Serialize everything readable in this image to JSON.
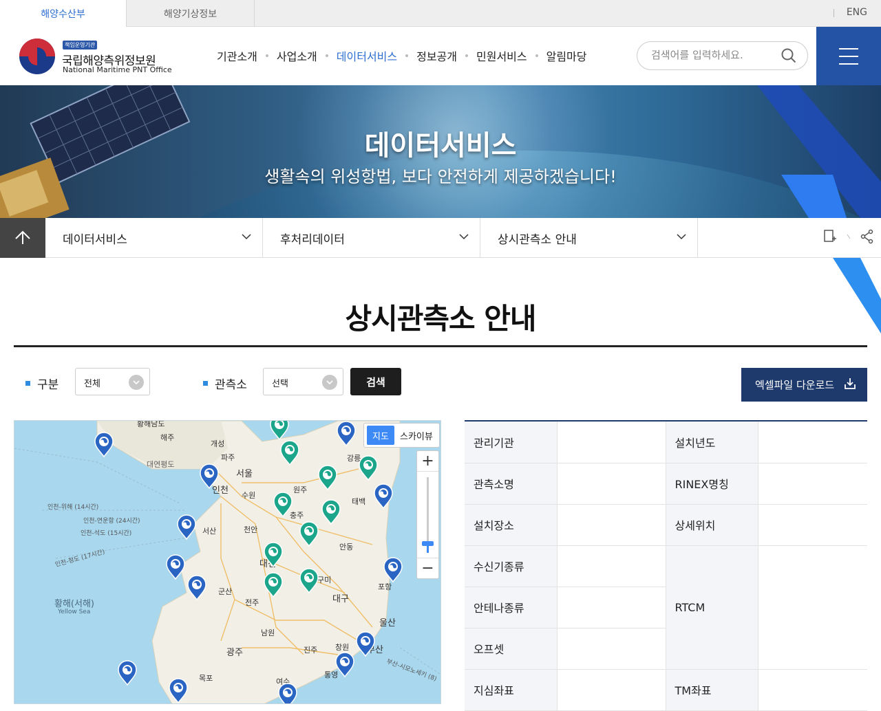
{
  "top_tabs": [
    "해양수산부",
    "해양기상정보"
  ],
  "lang": "ENG",
  "org": {
    "badge": "책임운영기관",
    "name": "국립해양측위정보원",
    "eng": "National Maritime PNT Office"
  },
  "gnb": [
    "기관소개",
    "사업소개",
    "데이터서비스",
    "정보공개",
    "민원서비스",
    "알림마당"
  ],
  "gnb_active": "데이터서비스",
  "search": {
    "placeholder": "검색어를 입력하세요."
  },
  "banner": {
    "title": "데이터서비스",
    "subtitle": "생활속의 위성항법, 보다 안전하게 제공하겠습니다!"
  },
  "breadcrumbs": [
    "데이터서비스",
    "후처리데이터",
    "상시관측소 안내"
  ],
  "page_title": "상시관측소 안내",
  "filters": {
    "category_label": "구분",
    "category_value": "전체",
    "station_label": "관측소",
    "station_value": "선택",
    "search_button": "검색",
    "excel_button": "엑셀파일 다운로드"
  },
  "map": {
    "toggle": [
      "지도",
      "스카이뷰"
    ],
    "zoom_in": "+",
    "zoom_out": "−",
    "zoom_level_fraction": 0.13,
    "labels": [
      "황해남도",
      "해주",
      "개성",
      "파주",
      "대연평도",
      "서울",
      "인천",
      "수원",
      "원주",
      "강릉",
      "태백",
      "충주",
      "천안",
      "서산",
      "대전",
      "안동",
      "구미",
      "군산",
      "전주",
      "대구",
      "포항",
      "울산",
      "남원",
      "광주",
      "진주",
      "창원",
      "부산",
      "통영",
      "여수",
      "목포",
      "황해(서해)",
      "Yellow Sea",
      "인천-위해 (14시간)",
      "인천-연운항 (24시간)",
      "인천-석도 (15시간)",
      "인천-청도 (17시간)",
      "부산-시모노세키 (8)"
    ],
    "pin_colors": {
      "blue": "#2a65c4",
      "teal": "#1ba58a"
    }
  },
  "info_table": {
    "rows": [
      [
        "관리기관",
        "",
        "설치년도",
        ""
      ],
      [
        "관측소명",
        "",
        "RINEX명칭",
        ""
      ],
      [
        "설치장소",
        "",
        "상세위치",
        ""
      ],
      [
        "수신기종류",
        "",
        "RTCM",
        ""
      ],
      [
        "안테나종류",
        ""
      ],
      [
        "오프셋",
        ""
      ],
      [
        "지심좌표",
        "",
        "TM좌표",
        ""
      ]
    ]
  },
  "colors": {
    "accent": "#2d6fd0",
    "navy": "#1e3a6d",
    "menu_bg": "#2453a6"
  }
}
